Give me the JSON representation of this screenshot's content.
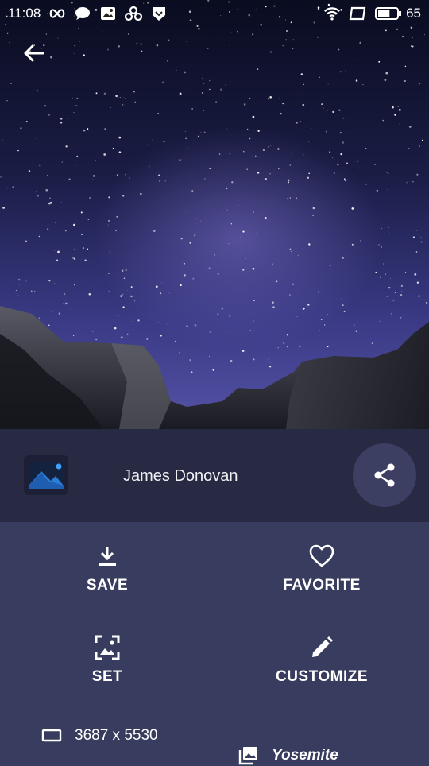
{
  "status_bar": {
    "time": "11:08",
    "battery_level": "65",
    "left_icons": [
      "infinity-icon",
      "chat-bubble-icon",
      "image-icon",
      "link-icon",
      "shield-icon"
    ],
    "right_icons": [
      "wifi-icon",
      "screen-icon",
      "battery-icon"
    ]
  },
  "photo": {
    "author": "James Donovan",
    "resolution": "3687 x 5530",
    "location": "Yosemite"
  },
  "actions": {
    "save": "SAVE",
    "favorite": "FAVORITE",
    "set": "SET",
    "customize": "CUSTOMIZE"
  },
  "colors": {
    "panel": "#383c5e",
    "author_bar": "#272a42",
    "share_button": "#3c3f62",
    "logo_blue": "#2b7cd8"
  }
}
